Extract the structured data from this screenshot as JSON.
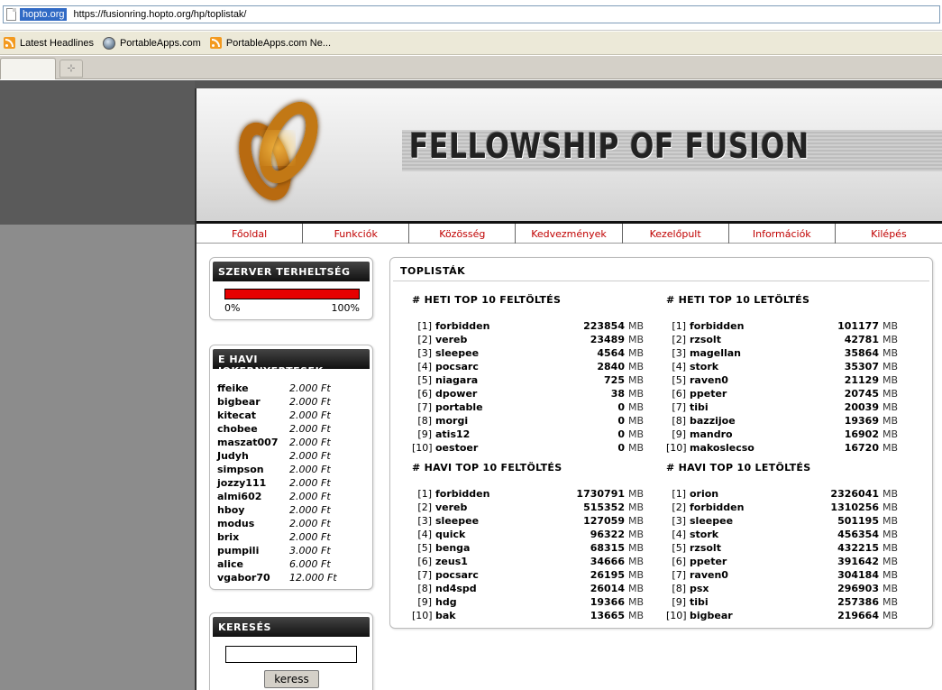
{
  "browser": {
    "host": "hopto.org",
    "url": "https://fusionring.hopto.org/hp/toplistak/",
    "bookmarks": [
      "Latest Headlines",
      "PortableApps.com",
      "PortableApps.com Ne..."
    ],
    "newtab_symbol": "⊹"
  },
  "site": {
    "title": "FELLOWSHIP OF FUSION",
    "nav": [
      "Főoldal",
      "Funkciók",
      "Közösség",
      "Kedvezmények",
      "Kezelőpult",
      "Információk",
      "Kilépés"
    ]
  },
  "server_load": {
    "title": "SZERVER TERHELTSÉG",
    "min_label": "0%",
    "max_label": "100%",
    "level_percent": 100,
    "bar_color": "#e60000"
  },
  "jokers": {
    "title": "E HAVI JOKERNYERTESEK",
    "rows": [
      {
        "name": "ffeike",
        "value": "2.000 Ft"
      },
      {
        "name": "bigbear",
        "value": "2.000 Ft"
      },
      {
        "name": "kitecat",
        "value": "2.000 Ft"
      },
      {
        "name": "chobee",
        "value": "2.000 Ft"
      },
      {
        "name": "maszat007",
        "value": "2.000 Ft"
      },
      {
        "name": "Judyh",
        "value": "2.000 Ft"
      },
      {
        "name": "simpson",
        "value": "2.000 Ft"
      },
      {
        "name": "jozzy111",
        "value": "2.000 Ft"
      },
      {
        "name": "almi602",
        "value": "2.000 Ft"
      },
      {
        "name": "hboy",
        "value": "2.000 Ft"
      },
      {
        "name": "modus",
        "value": "2.000 Ft"
      },
      {
        "name": "brix",
        "value": "2.000 Ft"
      },
      {
        "name": "pumpili",
        "value": "3.000 Ft"
      },
      {
        "name": "alice",
        "value": "6.000 Ft"
      },
      {
        "name": "vgabor70",
        "value": "12.000 Ft"
      }
    ]
  },
  "search": {
    "title": "KERESÉS",
    "button": "keress",
    "value": ""
  },
  "toplists": {
    "title": "TOPLISTÁK",
    "unit": "MB",
    "weekly_upload": {
      "heading": "# HETI TOP 10 FELTÖLTÉS",
      "rows": [
        {
          "rank": "[1]",
          "name": "forbidden",
          "value": "223854"
        },
        {
          "rank": "[2]",
          "name": "vereb",
          "value": "23489"
        },
        {
          "rank": "[3]",
          "name": "sleepee",
          "value": "4564"
        },
        {
          "rank": "[4]",
          "name": "pocsarc",
          "value": "2840"
        },
        {
          "rank": "[5]",
          "name": "niagara",
          "value": "725"
        },
        {
          "rank": "[6]",
          "name": "dpower",
          "value": "38"
        },
        {
          "rank": "[7]",
          "name": "portable",
          "value": "0"
        },
        {
          "rank": "[8]",
          "name": "morgi",
          "value": "0"
        },
        {
          "rank": "[9]",
          "name": "atis12",
          "value": "0"
        },
        {
          "rank": "[10]",
          "name": "oestoer",
          "value": "0"
        }
      ]
    },
    "weekly_download": {
      "heading": "# HETI TOP 10 LETÖLTÉS",
      "rows": [
        {
          "rank": "[1]",
          "name": "forbidden",
          "value": "101177"
        },
        {
          "rank": "[2]",
          "name": "rzsolt",
          "value": "42781"
        },
        {
          "rank": "[3]",
          "name": "magellan",
          "value": "35864"
        },
        {
          "rank": "[4]",
          "name": "stork",
          "value": "35307"
        },
        {
          "rank": "[5]",
          "name": "raven0",
          "value": "21129"
        },
        {
          "rank": "[6]",
          "name": "ppeter",
          "value": "20745"
        },
        {
          "rank": "[7]",
          "name": "tibi",
          "value": "20039"
        },
        {
          "rank": "[8]",
          "name": "bazzijoe",
          "value": "19369"
        },
        {
          "rank": "[9]",
          "name": "mandro",
          "value": "16902"
        },
        {
          "rank": "[10]",
          "name": "makoslecso",
          "value": "16720"
        }
      ]
    },
    "monthly_upload": {
      "heading": "# HAVI TOP 10 FELTÖLTÉS",
      "rows": [
        {
          "rank": "[1]",
          "name": "forbidden",
          "value": "1730791"
        },
        {
          "rank": "[2]",
          "name": "vereb",
          "value": "515352"
        },
        {
          "rank": "[3]",
          "name": "sleepee",
          "value": "127059"
        },
        {
          "rank": "[4]",
          "name": "quick",
          "value": "96322"
        },
        {
          "rank": "[5]",
          "name": "benga",
          "value": "68315"
        },
        {
          "rank": "[6]",
          "name": "zeus1",
          "value": "34666"
        },
        {
          "rank": "[7]",
          "name": "pocsarc",
          "value": "26195"
        },
        {
          "rank": "[8]",
          "name": "nd4spd",
          "value": "26014"
        },
        {
          "rank": "[9]",
          "name": "hdg",
          "value": "19366"
        },
        {
          "rank": "[10]",
          "name": "bak",
          "value": "13665"
        }
      ]
    },
    "monthly_download": {
      "heading": "# HAVI TOP 10 LETÖLTÉS",
      "rows": [
        {
          "rank": "[1]",
          "name": "orion",
          "value": "2326041"
        },
        {
          "rank": "[2]",
          "name": "forbidden",
          "value": "1310256"
        },
        {
          "rank": "[3]",
          "name": "sleepee",
          "value": "501195"
        },
        {
          "rank": "[4]",
          "name": "stork",
          "value": "456354"
        },
        {
          "rank": "[5]",
          "name": "rzsolt",
          "value": "432215"
        },
        {
          "rank": "[6]",
          "name": "ppeter",
          "value": "391642"
        },
        {
          "rank": "[7]",
          "name": "raven0",
          "value": "304184"
        },
        {
          "rank": "[8]",
          "name": "psx",
          "value": "296903"
        },
        {
          "rank": "[9]",
          "name": "tibi",
          "value": "257386"
        },
        {
          "rank": "[10]",
          "name": "bigbear",
          "value": "219664"
        }
      ]
    }
  }
}
